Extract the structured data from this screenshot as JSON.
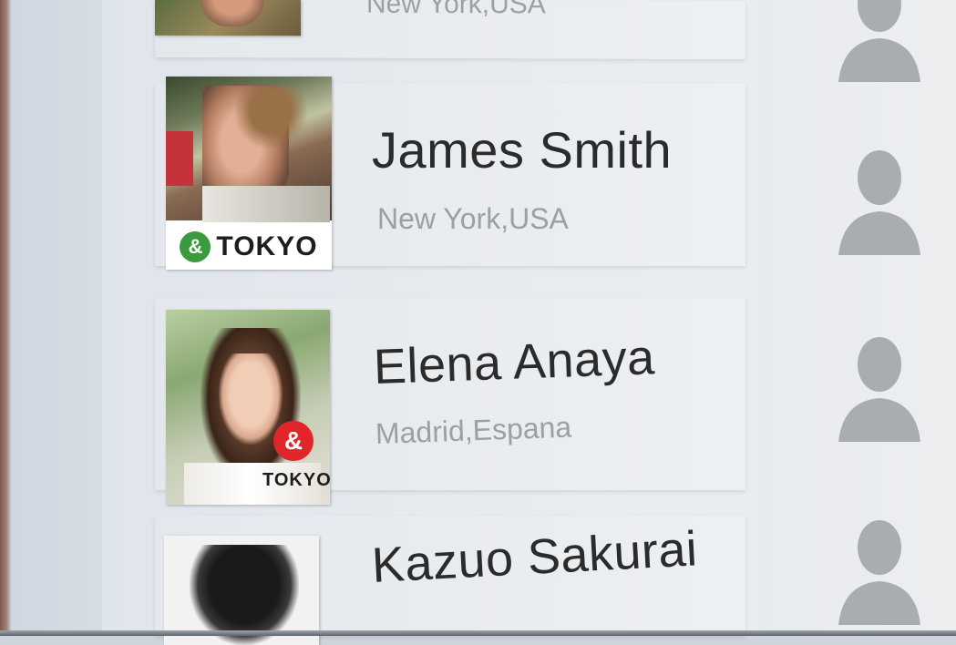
{
  "contacts": [
    {
      "name": "",
      "location": "New York,USA",
      "badge": null
    },
    {
      "name": "James Smith",
      "location": "New York,USA",
      "badge": {
        "symbol": "&",
        "label": "TOKYO",
        "color": "#3a9a3e"
      }
    },
    {
      "name": "Elena Anaya",
      "location": "Madrid,Espana",
      "badge": {
        "symbol": "&",
        "label": "TOKYO",
        "color": "#e0262b"
      }
    },
    {
      "name": "Kazuo Sakurai",
      "location": "",
      "badge": null
    }
  ],
  "colors": {
    "name_text": "#2b2b2b",
    "location_text": "#9aa0a6",
    "avatar_silhouette": "#a9adb1"
  },
  "icons": [
    "person-silhouette-icon"
  ]
}
